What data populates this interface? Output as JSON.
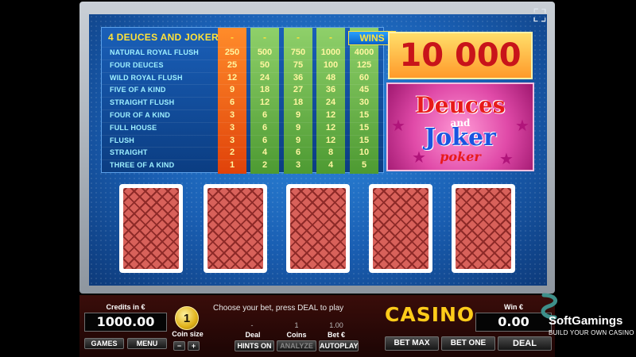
{
  "paytable": {
    "title": "4 DEUCES AND JOKER",
    "column_heads": [
      "-",
      "-",
      "-",
      "-",
      "WINS"
    ],
    "rows": [
      {
        "hand": "NATURAL ROYAL FLUSH",
        "values": [
          "250",
          "500",
          "750",
          "1000",
          "4000"
        ]
      },
      {
        "hand": "FOUR DEUCES",
        "values": [
          "25",
          "50",
          "75",
          "100",
          "125"
        ]
      },
      {
        "hand": "WILD ROYAL FLUSH",
        "values": [
          "12",
          "24",
          "36",
          "48",
          "60"
        ]
      },
      {
        "hand": "FIVE OF A KIND",
        "values": [
          "9",
          "18",
          "27",
          "36",
          "45"
        ]
      },
      {
        "hand": "STRAIGHT FLUSH",
        "values": [
          "6",
          "12",
          "18",
          "24",
          "30"
        ]
      },
      {
        "hand": "FOUR OF A KIND",
        "values": [
          "3",
          "6",
          "9",
          "12",
          "15"
        ]
      },
      {
        "hand": "FULL HOUSE",
        "values": [
          "3",
          "6",
          "9",
          "12",
          "15"
        ]
      },
      {
        "hand": "FLUSH",
        "values": [
          "3",
          "6",
          "9",
          "12",
          "15"
        ]
      },
      {
        "hand": "STRAIGHT",
        "values": [
          "2",
          "4",
          "6",
          "8",
          "10"
        ]
      },
      {
        "hand": "THREE OF A KIND",
        "values": [
          "1",
          "2",
          "3",
          "4",
          "5"
        ]
      }
    ]
  },
  "jackpot": "10 000",
  "logo": {
    "line1": "Deuces",
    "line2": "and",
    "line3": "Joker",
    "line4": "poker"
  },
  "cards": [
    "card-back",
    "card-back",
    "card-back",
    "card-back",
    "card-back"
  ],
  "panel": {
    "credits_label": "Credits in €",
    "credits_value": "1000.00",
    "games_label": "GAMES",
    "menu_label": "MENU",
    "coin_value": "1",
    "coin_size_label": "Coin size",
    "minus_label": "−",
    "plus_label": "+",
    "instruction": "Choose your bet, press DEAL to play",
    "deal_value": "-",
    "coins_value": "1",
    "bet_value": "1.00",
    "deal_label": "Deal",
    "coins_label": "Coins",
    "bet_label": "Bet €",
    "hints_label": "HINTS ON",
    "analyze_label": "ANALYZE",
    "autoplay_label": "AUTOPLAY",
    "casino_word": "CASINO",
    "win_label": "Win €",
    "win_value": "0.00",
    "bet_max_label": "BET MAX",
    "bet_one_label": "BET ONE",
    "deal_button_label": "DEAL"
  },
  "watermark": {
    "name": "SoftGamings",
    "tagline": "BUILD YOUR OWN CASINO"
  },
  "icons": {
    "fullscreen": "fullscreen-icon",
    "star": "star-icon"
  }
}
